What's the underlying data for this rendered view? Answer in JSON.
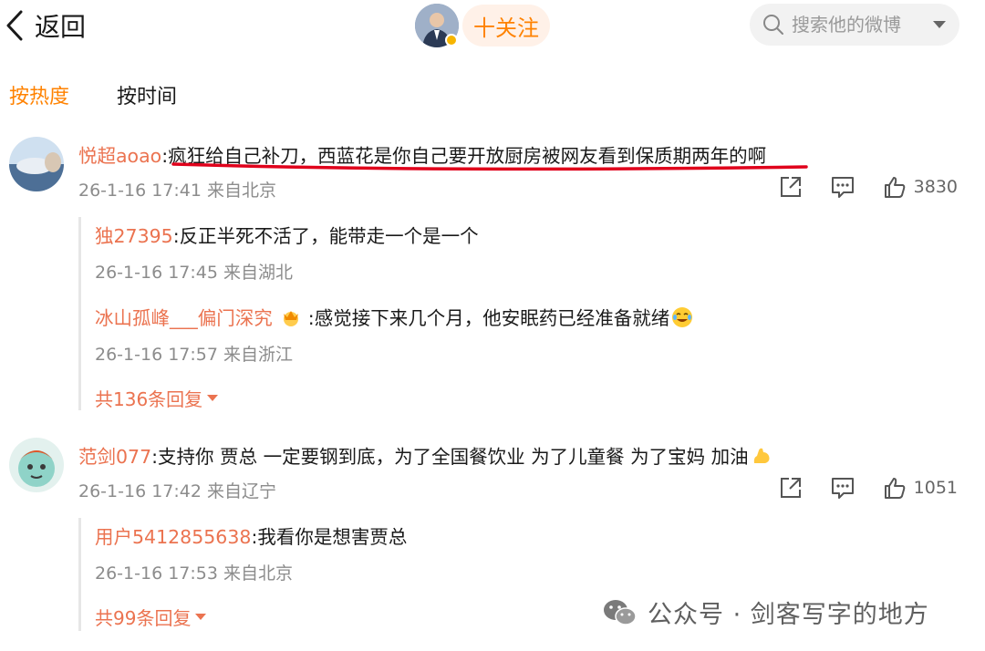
{
  "header": {
    "back_label": "返回",
    "follow_label": "十关注",
    "search_placeholder": "搜索他的微博"
  },
  "tabs": [
    {
      "label": "按热度",
      "active": true
    },
    {
      "label": "按时间",
      "active": false
    }
  ],
  "comments": [
    {
      "user": "悦超aoao",
      "text": ":疯狂给自己补刀，西蓝花是你自己要开放厨房被网友看到保质期两年的啊",
      "meta": "26-1-16 17:41 来自北京",
      "likes": "3830",
      "replies": [
        {
          "user": "独27395",
          "text": ":反正半死不活了，能带走一个是一个",
          "meta": "26-1-16 17:45 来自湖北"
        },
        {
          "user": "冰山孤峰___偏门深究",
          "text": " :感觉接下来几个月，他安眠药已经准备就绪",
          "meta": "26-1-16 17:57 来自浙江"
        }
      ],
      "more_replies": "共136条回复"
    },
    {
      "user": "范剑077",
      "text": ":支持你 贾总 一定要钢到底，为了全国餐饮业 为了儿童餐 为了宝妈 加油",
      "meta": "26-1-16 17:42 来自辽宁",
      "likes": "1051",
      "replies": [
        {
          "user": "用户5412855638",
          "text": ":我看你是想害贾总",
          "meta": "26-1-16 17:53 来自北京"
        }
      ],
      "more_replies": "共99条回复"
    }
  ],
  "watermark": "公众号 · 剑客写字的地方",
  "colors": {
    "accent": "#ff8200",
    "username": "#eb7350",
    "meta": "#8c8c8c",
    "underline": "#e0001b"
  }
}
